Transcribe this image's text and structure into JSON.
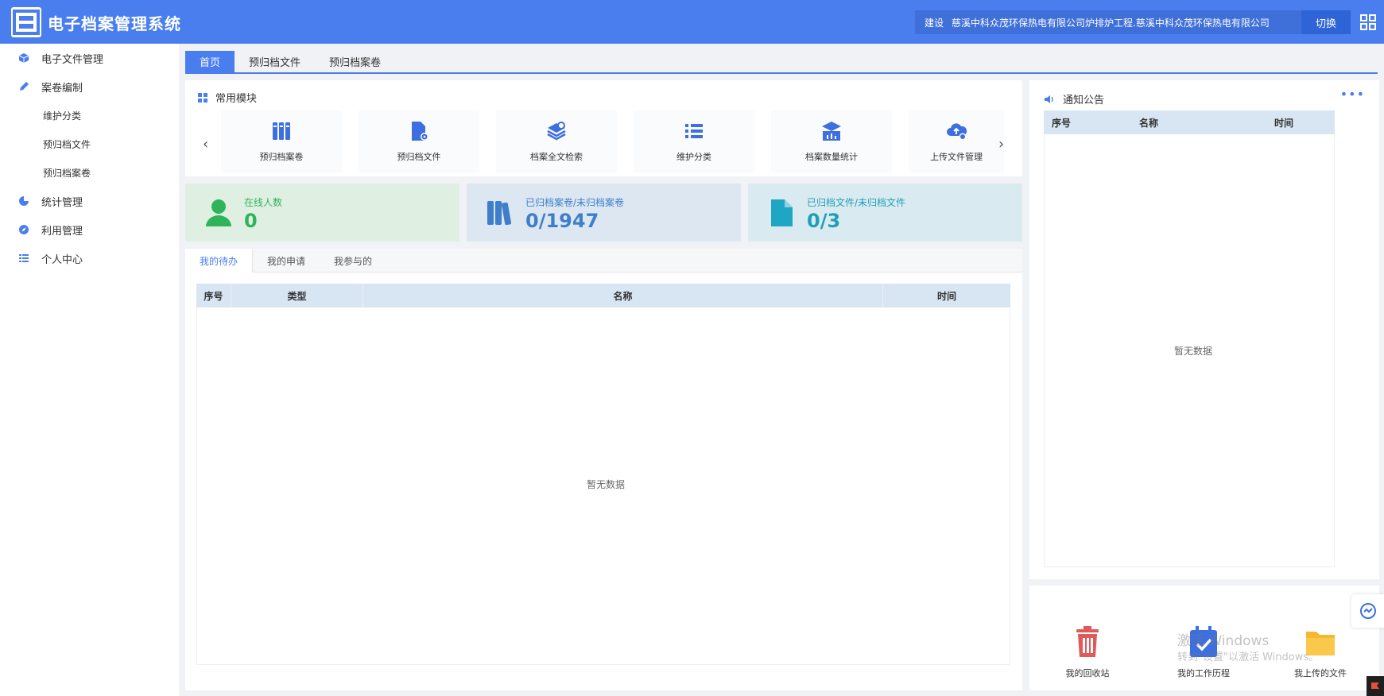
{
  "header": {
    "title": "电子档案管理系统",
    "org_prefix": "建设",
    "org_name": "慈溪中科众茂环保热电有限公司炉排炉工程.慈溪中科众茂环保热电有限公司",
    "switch_label": "切换"
  },
  "sidebar": {
    "items": [
      {
        "label": "电子文件管理",
        "icon": "cube-icon"
      },
      {
        "label": "案卷编制",
        "icon": "pencil-icon"
      },
      {
        "label": "统计管理",
        "icon": "pie-chart-icon"
      },
      {
        "label": "利用管理",
        "icon": "compass-icon"
      },
      {
        "label": "个人中心",
        "icon": "list-icon"
      }
    ],
    "subitems": [
      "维护分类",
      "预归档文件",
      "预归档案卷"
    ]
  },
  "top_tabs": [
    "首页",
    "预归档文件",
    "预归档案卷"
  ],
  "modules": {
    "title": "常用模块",
    "items": [
      {
        "label": "预归档案卷",
        "icon": "binders-icon"
      },
      {
        "label": "预归档文件",
        "icon": "file-gear-icon"
      },
      {
        "label": "档案全文检索",
        "icon": "layers-search-icon"
      },
      {
        "label": "维护分类",
        "icon": "list-icon"
      },
      {
        "label": "档案数量统计",
        "icon": "stats-box-icon"
      },
      {
        "label": "上传文件管理",
        "icon": "cloud-upload-icon"
      }
    ]
  },
  "stats": [
    {
      "label": "在线人数",
      "value": "0",
      "color": "#2fb45a",
      "bg": "#dff0e3"
    },
    {
      "label": "已归档案卷/未归档案卷",
      "value": "0/1947",
      "color": "#3f7fc9",
      "bg": "#dce7f2"
    },
    {
      "label": "已归档文件/未归档文件",
      "value": "0/3",
      "color": "#1f9fb8",
      "bg": "#d9eaf0"
    }
  ],
  "tasks": {
    "tabs": [
      "我的待办",
      "我的申请",
      "我参与的"
    ],
    "columns": [
      "序号",
      "类型",
      "名称",
      "时间"
    ],
    "empty": "暂无数据"
  },
  "notice": {
    "title": "通知公告",
    "more": "•••",
    "columns": [
      "序号",
      "名称",
      "时间"
    ],
    "empty": "暂无数据"
  },
  "quick_links": [
    {
      "label": "我的回收站",
      "icon": "trash-icon"
    },
    {
      "label": "我的工作历程",
      "icon": "calendar-check-icon"
    },
    {
      "label": "我上传的文件",
      "icon": "folder-icon"
    }
  ],
  "watermark": {
    "line1": "激活 Windows",
    "line2": "转到\"设置\"以激活 Windows。"
  },
  "colors": {
    "accent": "#4a7eef",
    "header": "#4a7eef"
  }
}
